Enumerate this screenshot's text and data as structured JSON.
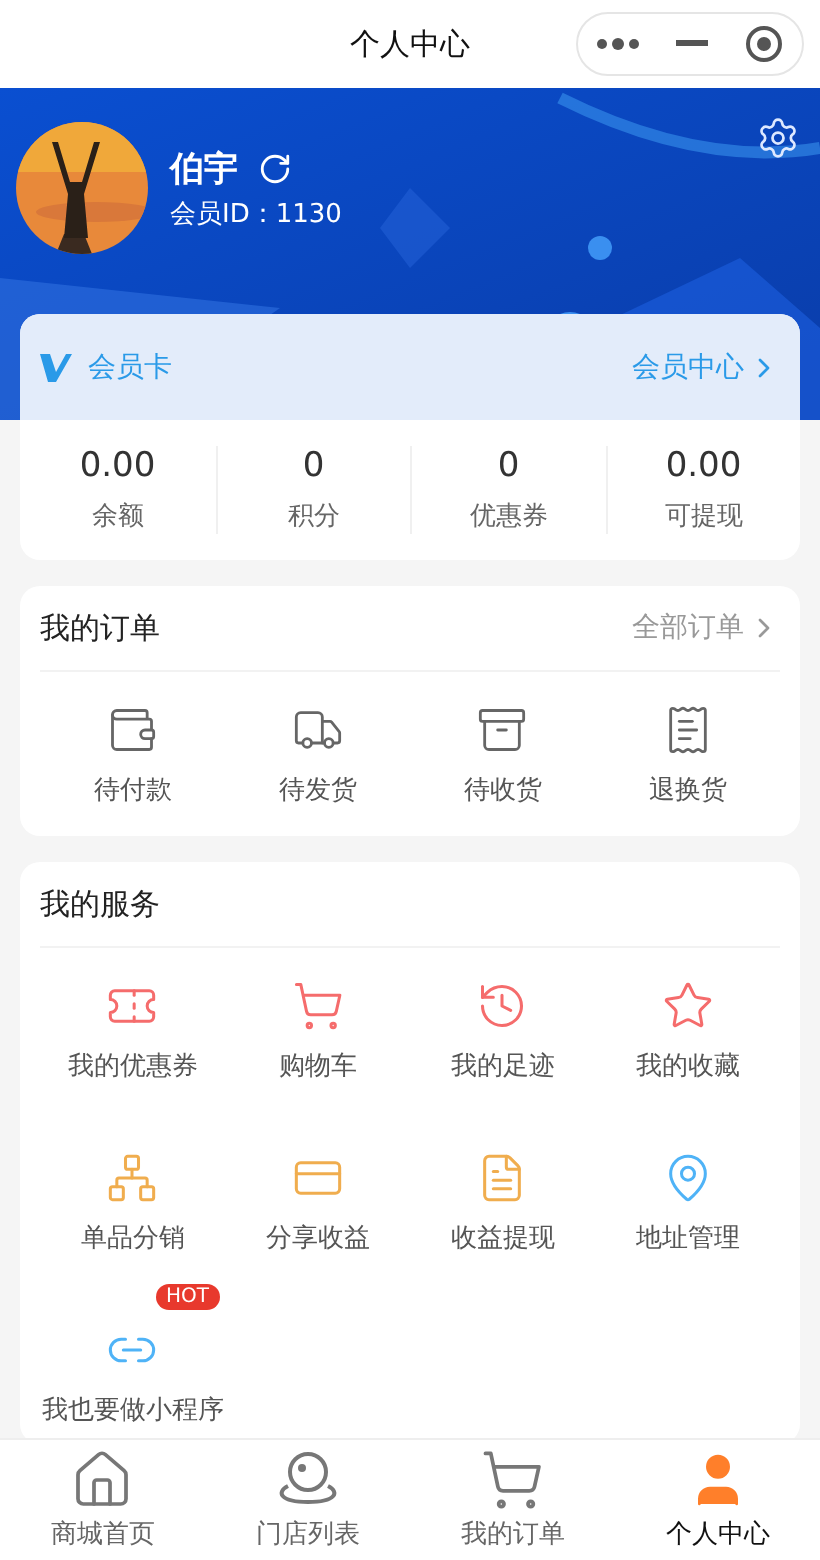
{
  "window": {
    "title": "个人中心"
  },
  "profile": {
    "name": "伯宇",
    "member_id": "会员ID：1130"
  },
  "member_card": {
    "title": "会员卡",
    "link": "会员中心"
  },
  "stats": [
    {
      "value": "0.00",
      "label": "余额"
    },
    {
      "value": "0",
      "label": "积分"
    },
    {
      "value": "0",
      "label": "优惠券"
    },
    {
      "value": "0.00",
      "label": "可提现"
    }
  ],
  "orders": {
    "title": "我的订单",
    "link": "全部订单",
    "items": [
      "待付款",
      "待发货",
      "待收货",
      "退换货"
    ]
  },
  "services": {
    "title": "我的服务",
    "items": [
      {
        "label": "我的优惠券",
        "color": "#f56c6c"
      },
      {
        "label": "购物车",
        "color": "#f56c6c"
      },
      {
        "label": "我的足迹",
        "color": "#f56c6c"
      },
      {
        "label": "我的收藏",
        "color": "#f56c6c"
      },
      {
        "label": "单品分销",
        "color": "#f0ad4e"
      },
      {
        "label": "分享收益",
        "color": "#f0ad4e"
      },
      {
        "label": "收益提现",
        "color": "#f0ad4e"
      },
      {
        "label": "地址管理",
        "color": "#4fb3f7"
      },
      {
        "label": "我也要做小程序",
        "color": "#4fb3f7",
        "badge": "HOT"
      }
    ]
  },
  "tab_bar": [
    {
      "label": "商城首页",
      "selected": false
    },
    {
      "label": "门店列表",
      "selected": false
    },
    {
      "label": "我的订单",
      "selected": false
    },
    {
      "label": "个人中心",
      "selected": true
    }
  ]
}
